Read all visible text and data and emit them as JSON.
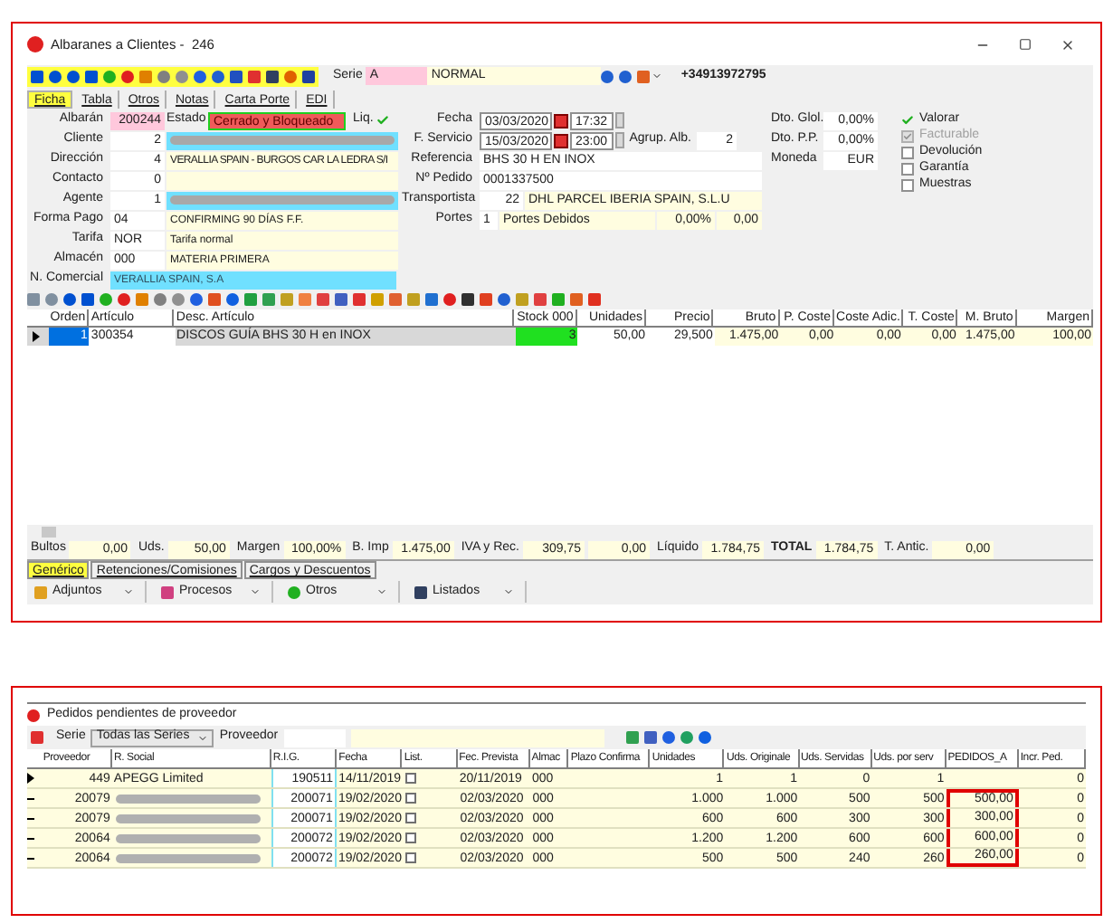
{
  "window": {
    "title": "Albaranes a Clientes -  246"
  },
  "toolbar": {
    "serie_label": "Serie",
    "serie": "A",
    "serie_name": "NORMAL",
    "phone": "+34913972795"
  },
  "tabs": [
    {
      "label": "Ficha",
      "selected": true
    },
    {
      "label": "Tabla",
      "selected": false
    },
    {
      "label": "Otros",
      "selected": false
    },
    {
      "label": "Notas",
      "selected": false
    },
    {
      "label": "Carta Porte",
      "selected": false
    },
    {
      "label": "EDI",
      "selected": false
    }
  ],
  "estado": {
    "label": "Estado",
    "value": "Cerrado y Bloqueado",
    "liq_label": "Liq.",
    "liq_checked": true
  },
  "left_fields": [
    {
      "label": "Albarán",
      "code": "200244",
      "kind": "pink"
    },
    {
      "label": "Cliente",
      "code": "2",
      "kind": "redacted"
    },
    {
      "label": "Dirección",
      "code": "4",
      "value": "VERALLIA SPAIN - BURGOS CAR LA LEDRA S/I",
      "kind": "text"
    },
    {
      "label": "Contacto",
      "code": "0",
      "kind": "text"
    },
    {
      "label": "Agente",
      "code": "1",
      "kind": "redacted"
    },
    {
      "label": "Forma Pago",
      "code": "04",
      "value": "CONFIRMING 90 DÍAS F.F.",
      "kind": "text_left"
    },
    {
      "label": "Tarifa",
      "code": "NOR",
      "value": "Tarifa normal",
      "kind": "text_left"
    },
    {
      "label": "Almacén",
      "code": "000",
      "value": "MATERIA PRIMERA",
      "kind": "text_left"
    },
    {
      "label": "N. Comercial",
      "value": "VERALLIA SPAIN, S.A",
      "kind": "cyan"
    }
  ],
  "middle": {
    "fecha": {
      "label": "Fecha",
      "date": "03/03/2020",
      "time": "17:32"
    },
    "f_servicio": {
      "label": "F. Servicio",
      "date": "15/03/2020",
      "time": "23:00"
    },
    "agrup": {
      "label": "Agrup. Alb.",
      "value": "2"
    },
    "referencia": {
      "label": "Referencia",
      "value": "BHS 30 H EN INOX"
    },
    "n_pedido": {
      "label": "Nº Pedido",
      "value": "0001337500"
    },
    "transportista": {
      "label": "Transportista",
      "code": "22",
      "value": "DHL PARCEL IBERIA SPAIN, S.L.U"
    },
    "portes": {
      "label": "Portes",
      "code": "1",
      "value": "Portes Debidos",
      "pct": "0,00%",
      "amount": "0,00"
    }
  },
  "right_fields": [
    {
      "label": "Dto. Glol.",
      "value": "0,00%"
    },
    {
      "label": "Dto. P.P.",
      "value": "0,00%"
    },
    {
      "label": "Moneda",
      "value": "EUR"
    }
  ],
  "checks": [
    {
      "label": "Valorar",
      "checked": true,
      "disabled": false
    },
    {
      "label": "Facturable",
      "checked": true,
      "disabled": true
    },
    {
      "label": "Devolución",
      "checked": false,
      "disabled": false
    },
    {
      "label": "Garantía",
      "checked": false,
      "disabled": false
    },
    {
      "label": "Muestras",
      "checked": false,
      "disabled": false
    }
  ],
  "lines": {
    "columns": [
      "Orden",
      "Artículo",
      "Desc. Artículo",
      "Stock 000",
      "Unidades",
      "Precio",
      "Bruto",
      "P. Coste",
      "Coste Adic.",
      "T. Coste",
      "M. Bruto",
      "Margen"
    ],
    "rows": [
      [
        "1",
        "300354",
        "DISCOS GUÍA BHS 30 H en INOX",
        "3",
        "50,00",
        "29,500",
        "1.475,00",
        "0,00",
        "0,00",
        "0,00",
        "1.475,00",
        "100,00"
      ]
    ]
  },
  "totals": [
    {
      "label": "Bultos",
      "value": "0,00"
    },
    {
      "label": "Uds.",
      "value": "50,00"
    },
    {
      "label": "Margen",
      "value": "100,00%"
    },
    {
      "label": "B. Imp",
      "value": "1.475,00"
    },
    {
      "label": "IVA y Rec.",
      "value": "309,75"
    },
    {
      "value": "0,00"
    },
    {
      "label": "Líquido",
      "value": "1.784,75"
    },
    {
      "label": "TOTAL",
      "value": "1.784,75",
      "bold": true
    },
    {
      "label": "T. Antic.",
      "value": "0,00"
    }
  ],
  "bottom_tabs": [
    {
      "label": "Genérico",
      "selected": true
    },
    {
      "label": "Retenciones/Comisiones",
      "selected": false
    },
    {
      "label": "Cargos y Descuentos",
      "selected": false
    }
  ],
  "actions": [
    "Adjuntos",
    "Procesos",
    "Otros",
    "Listados"
  ],
  "pedidos": {
    "title": "Pedidos pendientes de proveedor",
    "serie_label": "Serie",
    "serie": "Todas las Series",
    "proveedor_label": "Proveedor",
    "columns": [
      "Proveedor",
      "R. Social",
      "R.I.G.",
      "Fecha",
      "List.",
      "Fec. Prevista",
      "Almac",
      "Plazo Confirma",
      "Unidades",
      "Uds. Originale",
      "Uds. Servidas",
      "Uds. por serv",
      "PEDIDOS_A",
      "Incr. Ped."
    ],
    "rows": [
      {
        "cells": [
          "449",
          "APEGG Limited",
          "190511",
          "14/11/2019",
          "",
          "20/11/2019",
          "000",
          "",
          "1",
          "1",
          "0",
          "1",
          "",
          "0"
        ],
        "redacted": false,
        "highlighted": false,
        "list_checked": false
      },
      {
        "cells": [
          "20079",
          "",
          "200071",
          "19/02/2020",
          "",
          "02/03/2020",
          "000",
          "",
          "1.000",
          "1.000",
          "500",
          "500",
          "500,00",
          "0"
        ],
        "redacted": true,
        "highlighted": true,
        "list_checked": false
      },
      {
        "cells": [
          "20079",
          "",
          "200071",
          "19/02/2020",
          "",
          "02/03/2020",
          "000",
          "",
          "600",
          "600",
          "300",
          "300",
          "300,00",
          "0"
        ],
        "redacted": true,
        "highlighted": true,
        "list_checked": false
      },
      {
        "cells": [
          "20064",
          "",
          "200072",
          "19/02/2020",
          "",
          "02/03/2020",
          "000",
          "",
          "1.200",
          "1.200",
          "600",
          "600",
          "600,00",
          "0"
        ],
        "redacted": true,
        "highlighted": true,
        "list_checked": false
      },
      {
        "cells": [
          "20064",
          "",
          "200072",
          "19/02/2020",
          "",
          "02/03/2020",
          "000",
          "",
          "500",
          "500",
          "240",
          "260",
          "260,00",
          "0"
        ],
        "redacted": true,
        "highlighted": true,
        "list_checked": false
      }
    ]
  }
}
